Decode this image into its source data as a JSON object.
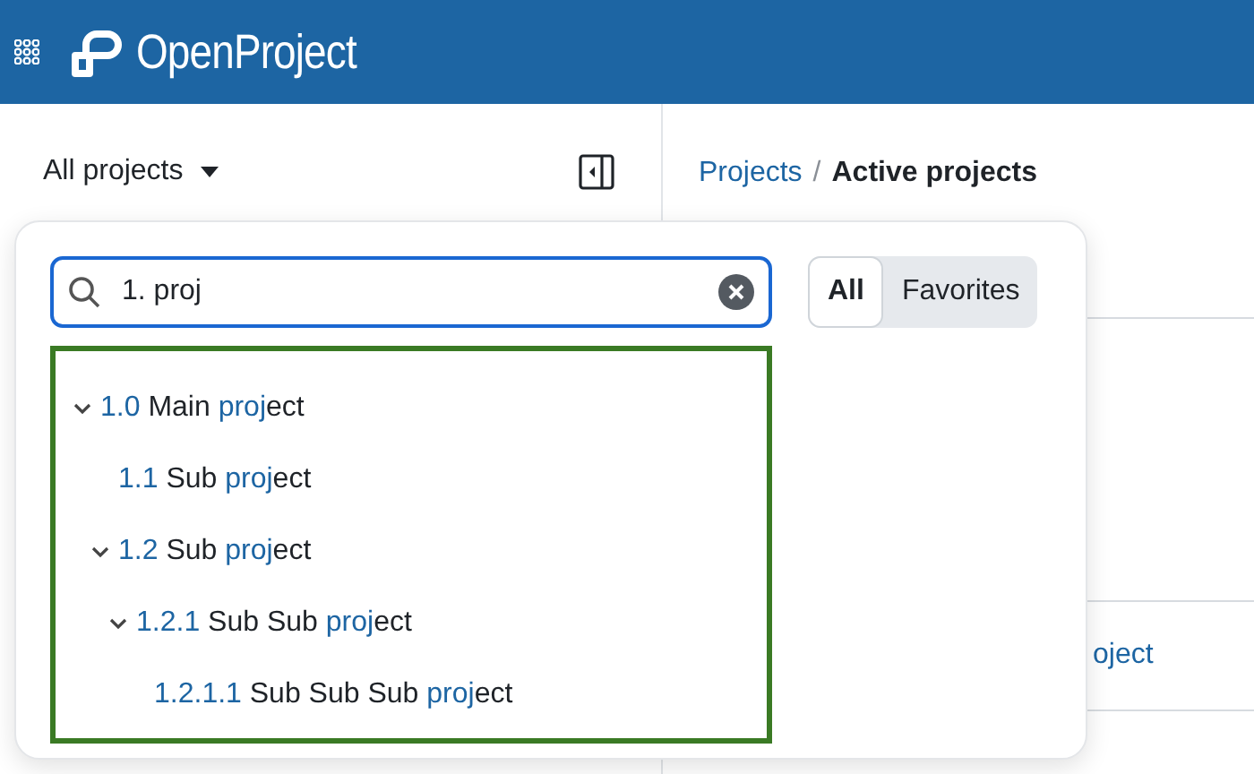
{
  "header": {
    "logo_text": "OpenProject"
  },
  "sidebar": {
    "project_selector": "All projects"
  },
  "breadcrumb": {
    "link": "Projects",
    "separator": "/",
    "current": "Active projects"
  },
  "background_rows": [
    {
      "text": "oject"
    }
  ],
  "popover": {
    "search": {
      "value": "1. proj"
    },
    "filters": [
      {
        "label": "All",
        "selected": true
      },
      {
        "label": "Favorites",
        "selected": false
      }
    ],
    "tree": [
      {
        "parts": [
          {
            "text": "1.0",
            "match": true
          },
          {
            "text": " Main ",
            "match": false
          },
          {
            "text": "proj",
            "match": true
          },
          {
            "text": "ect",
            "match": false
          }
        ],
        "expanded": true,
        "children": [
          {
            "parts": [
              {
                "text": "1.1",
                "match": true
              },
              {
                "text": " Sub ",
                "match": false
              },
              {
                "text": "proj",
                "match": true
              },
              {
                "text": "ect",
                "match": false
              }
            ]
          },
          {
            "parts": [
              {
                "text": "1.2",
                "match": true
              },
              {
                "text": " Sub ",
                "match": false
              },
              {
                "text": "proj",
                "match": true
              },
              {
                "text": "ect",
                "match": false
              }
            ],
            "expanded": true,
            "children": [
              {
                "parts": [
                  {
                    "text": "1.2.1",
                    "match": true
                  },
                  {
                    "text": " Sub Sub ",
                    "match": false
                  },
                  {
                    "text": "proj",
                    "match": true
                  },
                  {
                    "text": "ect",
                    "match": false
                  }
                ],
                "expanded": true,
                "children": [
                  {
                    "parts": [
                      {
                        "text": "1.2.1.1",
                        "match": true
                      },
                      {
                        "text": " Sub Sub Sub ",
                        "match": false
                      },
                      {
                        "text": "proj",
                        "match": true
                      },
                      {
                        "text": "ect",
                        "match": false
                      }
                    ]
                  }
                ]
              }
            ]
          }
        ]
      }
    ]
  }
}
